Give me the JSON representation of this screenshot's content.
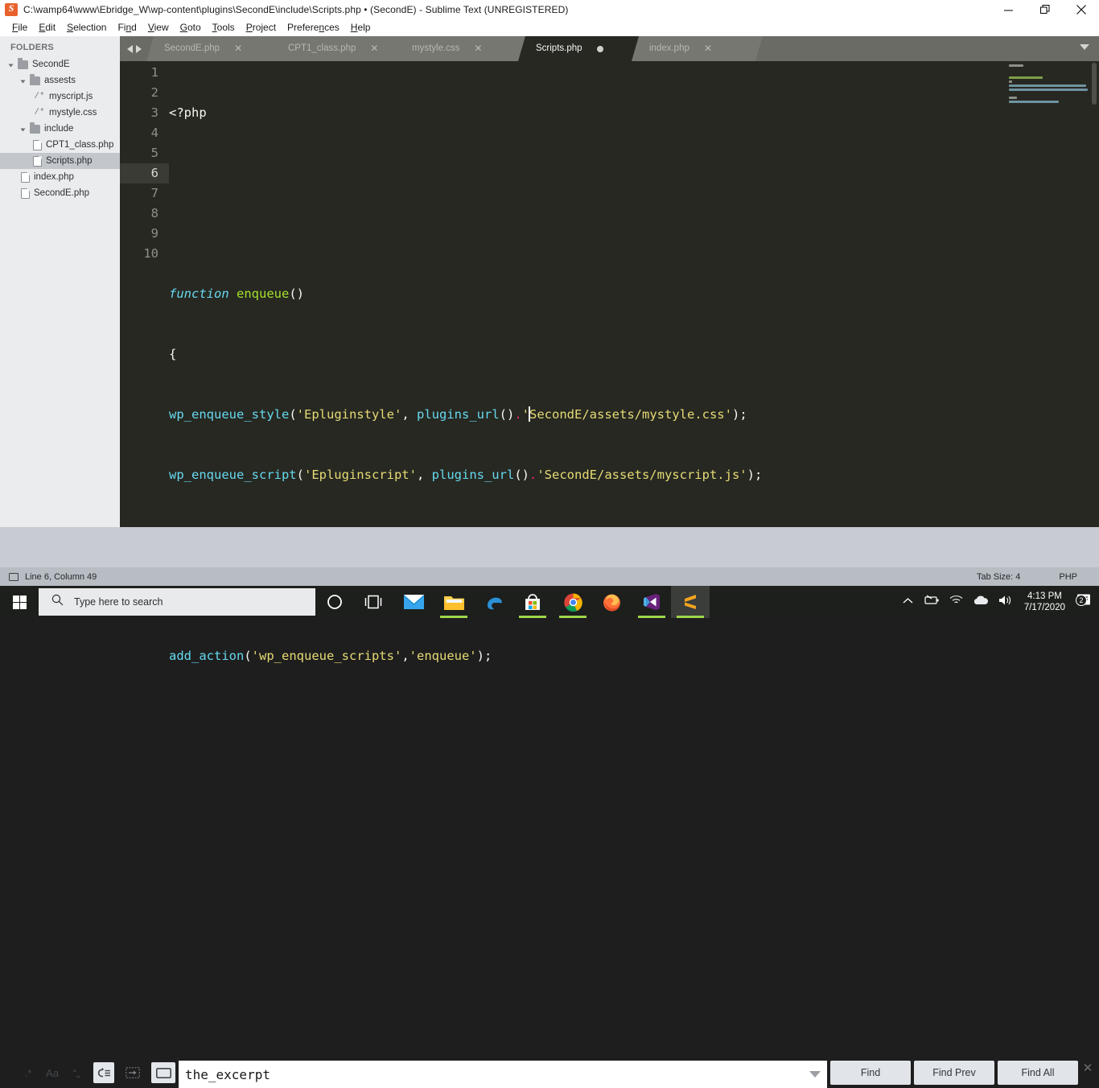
{
  "window": {
    "title": "C:\\wamp64\\www\\Ebridge_W\\wp-content\\plugins\\SecondE\\include\\Scripts.php • (SecondE) - Sublime Text (UNREGISTERED)",
    "app_icon": "sublime-text-icon",
    "controls": {
      "minimize": "−",
      "restore": "❐",
      "close": "✕"
    }
  },
  "menu": [
    {
      "label": "File",
      "mnemonic": "F"
    },
    {
      "label": "Edit",
      "mnemonic": "E"
    },
    {
      "label": "Selection",
      "mnemonic": "S"
    },
    {
      "label": "Find",
      "mnemonic": "n"
    },
    {
      "label": "View",
      "mnemonic": "V"
    },
    {
      "label": "Goto",
      "mnemonic": "G"
    },
    {
      "label": "Tools",
      "mnemonic": "T"
    },
    {
      "label": "Project",
      "mnemonic": "P"
    },
    {
      "label": "Preferences",
      "mnemonic": "n"
    },
    {
      "label": "Help",
      "mnemonic": "H"
    }
  ],
  "sidebar": {
    "header": "FOLDERS",
    "tree": [
      {
        "label": "SecondE",
        "type": "folder",
        "depth": 0,
        "open": true,
        "selected": false
      },
      {
        "label": "assests",
        "type": "folder",
        "depth": 1,
        "open": true,
        "selected": false
      },
      {
        "label": "myscript.js",
        "type": "code",
        "depth": 2,
        "icon": "/*",
        "selected": false
      },
      {
        "label": "mystyle.css",
        "type": "code",
        "depth": 2,
        "icon": "/*",
        "selected": false
      },
      {
        "label": "include",
        "type": "folder",
        "depth": 1,
        "open": true,
        "selected": false
      },
      {
        "label": "CPT1_class.php",
        "type": "file",
        "depth": 2,
        "selected": false
      },
      {
        "label": "Scripts.php",
        "type": "file",
        "depth": 2,
        "selected": true
      },
      {
        "label": "index.php",
        "type": "file",
        "depth": 1,
        "selected": false
      },
      {
        "label": "SecondE.php",
        "type": "file",
        "depth": 1,
        "selected": false
      }
    ]
  },
  "tabs": [
    {
      "label": "SecondE.php",
      "active": false,
      "modified": false,
      "close": "✕"
    },
    {
      "label": "CPT1_class.php",
      "active": false,
      "modified": false,
      "close": "✕"
    },
    {
      "label": "mystyle.css",
      "active": false,
      "modified": false,
      "close": "✕"
    },
    {
      "label": "Scripts.php",
      "active": true,
      "modified": true,
      "close": "✕"
    },
    {
      "label": "index.php",
      "active": false,
      "modified": false,
      "close": "✕"
    }
  ],
  "editor": {
    "line_numbers": [
      "1",
      "2",
      "3",
      "4",
      "5",
      "6",
      "7",
      "8",
      "9",
      "10"
    ],
    "current_line": 6,
    "code_lines": [
      "<?php",
      "",
      "",
      "function enqueue()",
      "{",
      "wp_enqueue_style('Epluginstyle', plugins_url().'SecondE/assets/mystyle.css');",
      "wp_enqueue_script('Epluginscript', plugins_url().'SecondE/assets/myscript.js');",
      "",
      "        }",
      "add_action('wp_enqueue_scripts','enqueue');"
    ],
    "colors": {
      "background": "#272822",
      "foreground": "#f8f8f2",
      "keyword": "#66d9ef",
      "function": "#a6e22e",
      "string": "#e6db74",
      "operator": "#f92672",
      "gutter": "#8f908a"
    }
  },
  "findbar": {
    "toggles": [
      {
        "name": "regex",
        "glyph": ".*",
        "on": false
      },
      {
        "name": "case",
        "glyph": "Aa",
        "on": false
      },
      {
        "name": "whole-word",
        "glyph": "“„",
        "on": false
      },
      {
        "name": "wrap",
        "glyph": "↻≡",
        "on": true
      },
      {
        "name": "in-selection",
        "glyph": "⇥",
        "on": false
      },
      {
        "name": "highlight",
        "glyph": "▭",
        "on": true
      }
    ],
    "query": "the_excerpt",
    "placeholder": "Find",
    "buttons": [
      {
        "label": "Find"
      },
      {
        "label": "Find Prev"
      },
      {
        "label": "Find All"
      }
    ],
    "close": "✕"
  },
  "status": {
    "position": "Line 6, Column 49",
    "tab_size": "Tab Size: 4",
    "syntax": "PHP"
  },
  "taskbar": {
    "start": "windows-logo",
    "search_placeholder": "Type here to search",
    "icons": [
      {
        "name": "cortana-icon",
        "running": false
      },
      {
        "name": "task-view-icon",
        "running": false
      },
      {
        "name": "mail-icon",
        "running": false
      },
      {
        "name": "file-explorer-icon",
        "running": true
      },
      {
        "name": "edge-icon",
        "running": false
      },
      {
        "name": "microsoft-store-icon",
        "running": true
      },
      {
        "name": "chrome-icon",
        "running": true
      },
      {
        "name": "firefox-icon",
        "running": false
      },
      {
        "name": "visual-studio-icon",
        "running": true
      },
      {
        "name": "sublime-text-icon",
        "running": true,
        "active": true
      }
    ],
    "tray": {
      "show_hidden": "^",
      "items": [
        "battery-icon",
        "wifi-icon",
        "onedrive-icon",
        "volume-icon"
      ],
      "time": "4:13 PM",
      "date": "7/17/2020",
      "notification_count": "2"
    }
  }
}
